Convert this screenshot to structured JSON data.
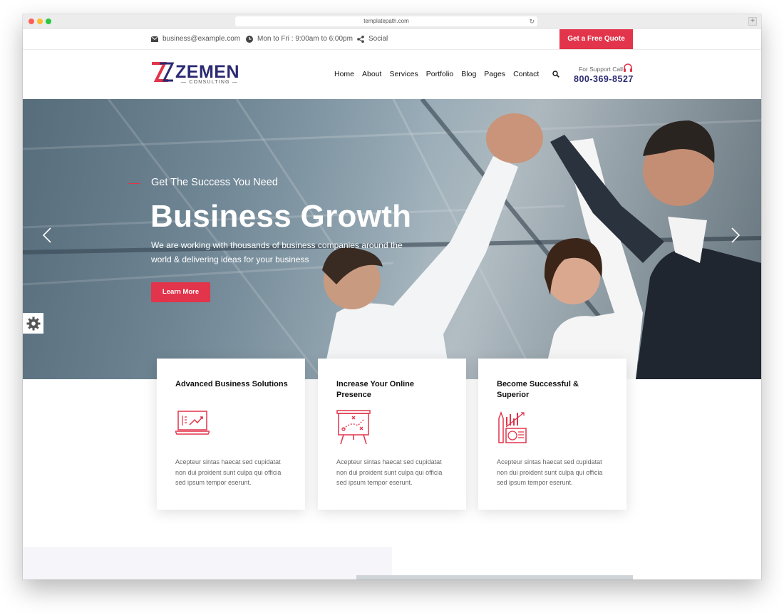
{
  "browser": {
    "url": "templatepath.com"
  },
  "topbar": {
    "email": "business@example.com",
    "hours": "Mon to Fri : 9:00am to 6:00pm",
    "social": "Social",
    "quote_button": "Get a Free Quote"
  },
  "header": {
    "logo_name": "ZEMEN",
    "logo_sub": "— CONSULTING —",
    "nav": [
      "Home",
      "About",
      "Services",
      "Portfolio",
      "Blog",
      "Pages",
      "Contact"
    ],
    "support_label": "For Support Call",
    "support_phone": "800-369-8527"
  },
  "hero": {
    "tagline": "Get The Success You Need",
    "title": "Business Growth",
    "description": "We are working with thousands of business companies around the world & delivering ideas for your business",
    "button": "Learn More"
  },
  "features": [
    {
      "title": "Advanced Business Solutions",
      "icon": "laptop-chart-icon",
      "text": "Acepteur sintas haecat sed cupidatat non dui proident sunt culpa qui officia sed ipsum tempor eserunt."
    },
    {
      "title": "Increase Your Online Presence",
      "icon": "strategy-board-icon",
      "text": "Acepteur sintas haecat sed cupidatat non dui proident sunt culpa qui officia sed ipsum tempor eserunt."
    },
    {
      "title": "Become Successful & Superior",
      "icon": "finance-growth-icon",
      "text": "Acepteur sintas haecat sed cupidatat non dui proident sunt culpa qui officia sed ipsum tempor eserunt."
    }
  ],
  "colors": {
    "accent": "#e2344a",
    "brand": "#2b2a72"
  }
}
